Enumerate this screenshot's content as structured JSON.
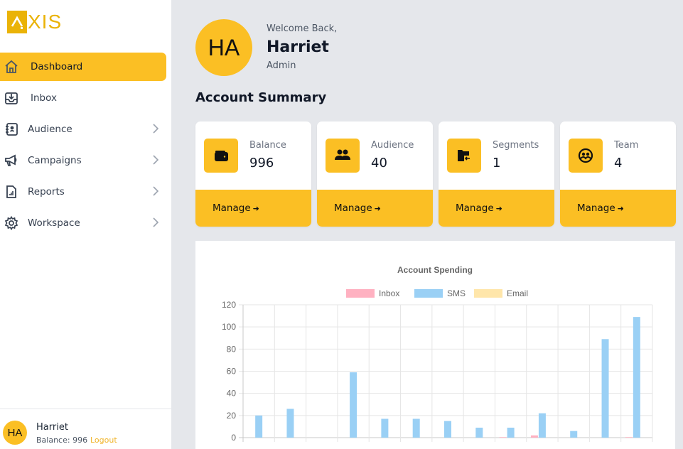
{
  "brand": {
    "name": "XIS",
    "accent": "#fbbf24"
  },
  "sidebar": {
    "items": [
      {
        "label": "Dashboard",
        "icon": "home-icon",
        "active": true,
        "has_children": false
      },
      {
        "label": "Inbox",
        "icon": "inbox-download-icon",
        "active": false,
        "has_children": false
      },
      {
        "label": "Audience",
        "icon": "contact-book-icon",
        "active": false,
        "has_children": true
      },
      {
        "label": "Campaigns",
        "icon": "megaphone-icon",
        "active": false,
        "has_children": true
      },
      {
        "label": "Reports",
        "icon": "report-chart-icon",
        "active": false,
        "has_children": true
      },
      {
        "label": "Workspace",
        "icon": "gear-icon",
        "active": false,
        "has_children": true
      }
    ],
    "footer": {
      "initials": "HA",
      "name": "Harriet",
      "balance_text": "Balance: 996",
      "logout_label": "Logout"
    }
  },
  "header": {
    "initials": "HA",
    "welcome": "Welcome Back,",
    "name": "Harriet",
    "role": "Admin"
  },
  "summary": {
    "title": "Account Summary",
    "cards": [
      {
        "label": "Balance",
        "value": "996",
        "icon": "wallet-icon",
        "action": "Manage"
      },
      {
        "label": "Audience",
        "value": "40",
        "icon": "users-icon",
        "action": "Manage"
      },
      {
        "label": "Segments",
        "value": "1",
        "icon": "folder-import-icon",
        "action": "Manage"
      },
      {
        "label": "Team",
        "value": "4",
        "icon": "team-circle-icon",
        "action": "Manage"
      }
    ]
  },
  "chart_data": {
    "type": "bar",
    "title": "Account Spending",
    "xlabel": "",
    "ylabel": "",
    "ylim": [
      0,
      120
    ],
    "yticks": [
      0,
      20,
      40,
      60,
      80,
      100,
      120
    ],
    "grid": true,
    "legend_position": "top",
    "categories": [
      "",
      "",
      "",
      "",
      "",
      "",
      "",
      "",
      "",
      "",
      "",
      "",
      ""
    ],
    "series": [
      {
        "name": "Inbox",
        "color": "#ffb1c1",
        "values": [
          0,
          0,
          0,
          0,
          0,
          0,
          0,
          0,
          0.5,
          2,
          0,
          0,
          0.5
        ]
      },
      {
        "name": "SMS",
        "color": "#9ad0f5",
        "values": [
          20,
          26,
          0,
          59,
          17,
          17,
          15,
          9,
          9,
          22,
          6,
          89,
          109
        ]
      },
      {
        "name": "Email",
        "color": "#ffe6aa",
        "values": [
          0,
          0,
          0,
          0,
          0,
          0,
          0,
          0,
          0,
          0,
          0,
          0,
          0
        ]
      }
    ]
  }
}
